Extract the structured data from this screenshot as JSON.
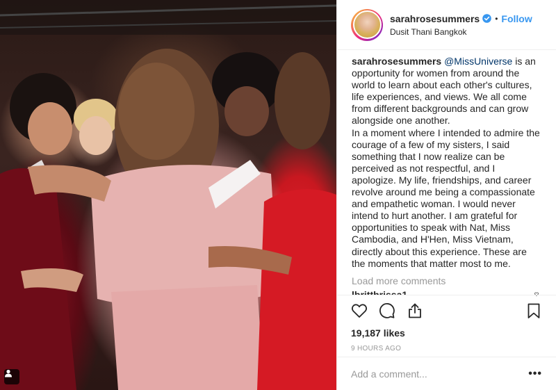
{
  "post": {
    "username": "sarahrosesummers",
    "follow_label": "Follow",
    "separator": "•",
    "location": "Dusit Thani Bangkok"
  },
  "caption": {
    "username": "sarahrosesummers",
    "mention": "@MissUniverse",
    "paragraph1_rest": " is an opportunity for women from around the world to learn about each other's cultures, life experiences, and views. We all come from different backgrounds and can grow alongside one another.",
    "paragraph2": "In a moment where I intended to admire the courage of a few of my sisters, I said something that I now realize can be perceived as not respectful, and I apologize. My life, friendships, and career revolve around me being a compassionate and empathetic woman. I would never intend to hurt another. I am grateful for opportunities to speak with Nat, Miss Cambodia, and H'Hen, Miss Vietnam, directly about this experience. These are the moments that matter most to me."
  },
  "comments": {
    "load_more_label": "Load more comments",
    "partial_username": "lbritthrissa1"
  },
  "actions": {
    "likes": "19,187 likes",
    "timestamp": "9 HOURS AGO"
  },
  "comment_box": {
    "placeholder": "Add a comment...",
    "more_label": "•••"
  },
  "icons": {
    "like": "heart-icon",
    "comment": "comment-bubble-icon",
    "share": "share-upload-icon",
    "save": "bookmark-icon",
    "verified": "verified-badge-icon",
    "photo_badge": "user-tag-icon"
  },
  "colors": {
    "accent_link": "#3897f0",
    "mention": "#003569",
    "muted": "#999999",
    "text": "#262626"
  }
}
